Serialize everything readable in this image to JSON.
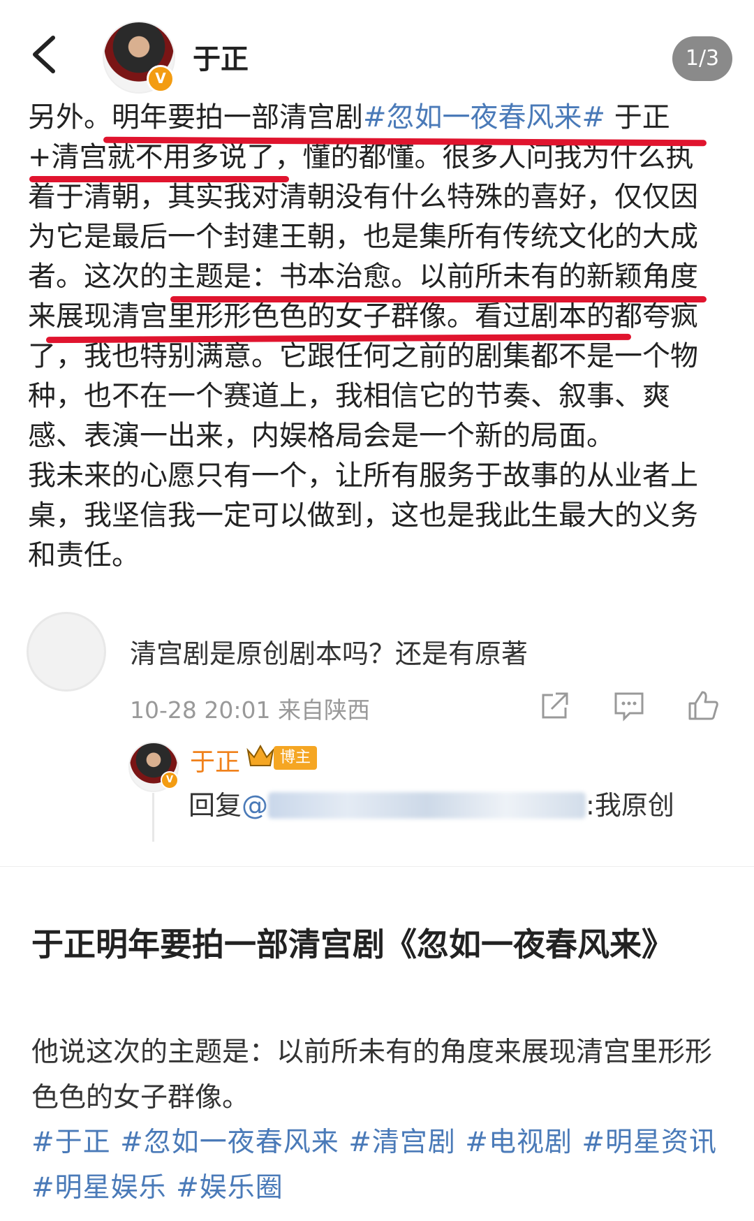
{
  "header": {
    "username": "于正",
    "pager": "1/3",
    "verified_badge": "V"
  },
  "post": {
    "paragraphs": [
      [
        {
          "text": "另外。明年要拍一部清宫剧",
          "hashtag": false
        },
        {
          "text": "#忽如一夜春风来#",
          "hashtag": true
        },
        {
          "text": " 于正+清宫就不用多说了，懂的都懂。很多人问我为什么执着于清朝，其实我对清朝没有什么特殊的喜好，仅仅因为它是最后一个封建王朝，也是集所有传统文化的大成者。这次的主题是：书本治愈。以前所未有的新颖角度来展现清宫里形形色色的女子群像。看过剧本的都夸疯了，我也特别满意。它跟任何之前的剧集都不是一个物种，也不在一个赛道上，我相信它的节奏、叙事、爽感、表演一出来，内娱格局会是一个新的局面。",
          "hashtag": false
        }
      ],
      [
        {
          "text": "我未来的心愿只有一个，让所有服务于故事的从业者上桌，我坚信我一定可以做到，这也是我此生最大的义务和责任。",
          "hashtag": false
        }
      ]
    ]
  },
  "comment": {
    "text": "清宫剧是原创剧本吗？还是有原著",
    "time": "10-28 20:01  来自陕西",
    "actions": [
      "share-icon",
      "comment-icon",
      "like-icon"
    ]
  },
  "reply": {
    "name": "于正",
    "badge": "博主",
    "prefix": "回复",
    "at_symbol": "@",
    "suffix": ":我原创"
  },
  "carousel": {
    "count": 3,
    "active_index": 0
  },
  "article": {
    "title": "于正明年要拍一部清宫剧《忽如一夜春风来》",
    "body": "他说这次的主题是：以前所未有的角度来展现清宫里形形色色的女子群像。",
    "tags": [
      "#于正",
      "#忽如一夜春风来",
      "#清宫剧",
      "#电视剧",
      "#明星资讯",
      "#明星娱乐",
      "#娱乐圈"
    ]
  },
  "colors": {
    "hashtag": "#4a7ab8",
    "underline": "#e0142e",
    "reply_name": "#f0811b",
    "badge": "#f5a623"
  }
}
